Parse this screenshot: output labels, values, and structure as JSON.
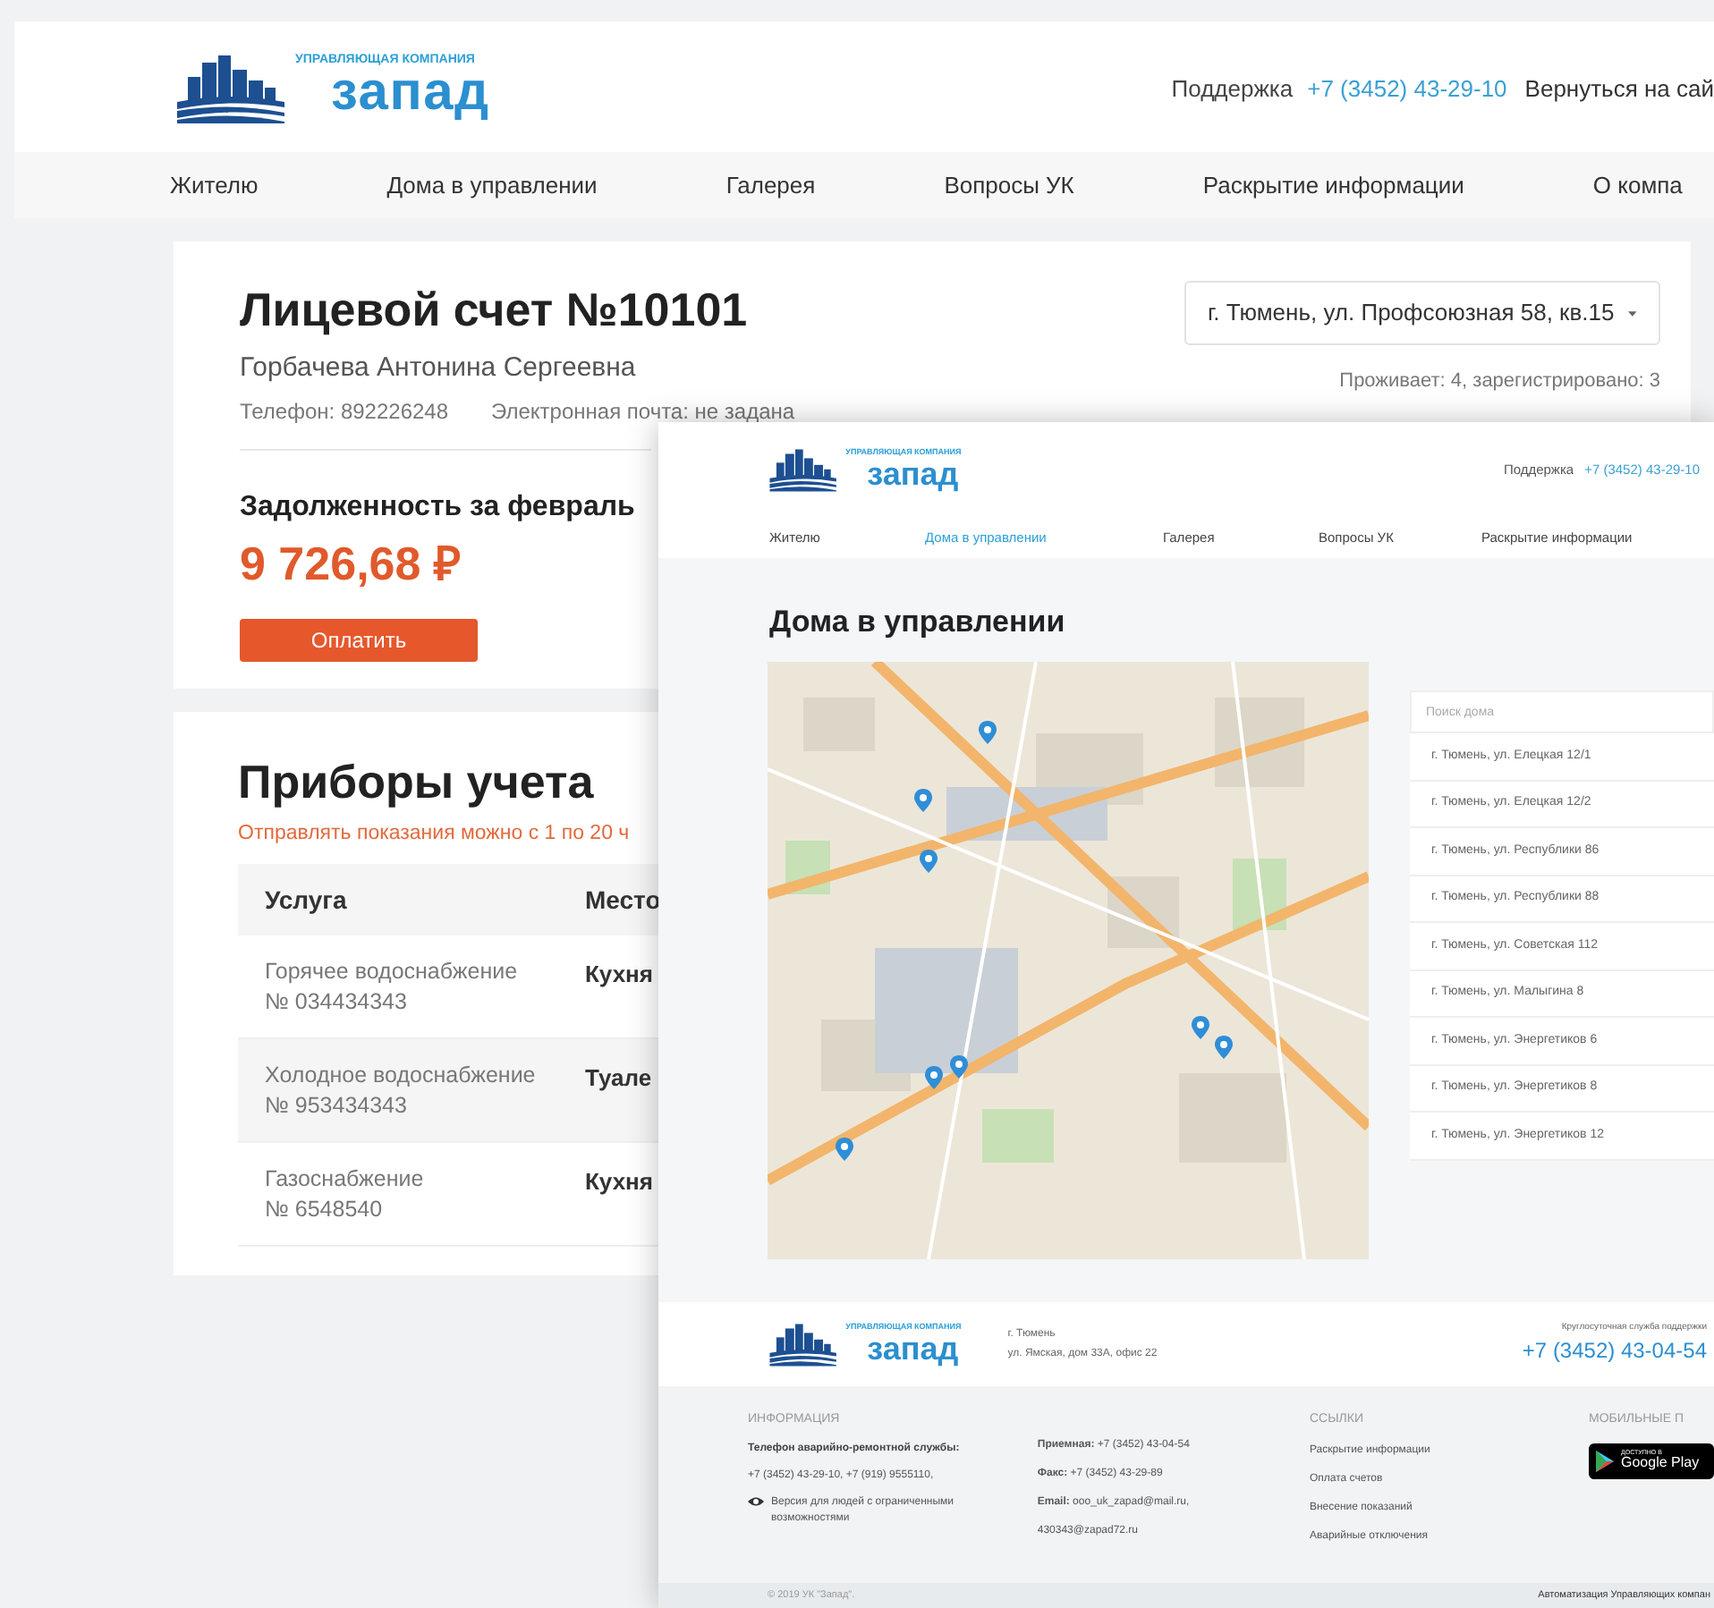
{
  "back_page": {
    "header": {
      "logo_tagline": "УПРАВЛЯЮЩАЯ КОМПАНИЯ",
      "logo_name": "запад",
      "support_label": "Поддержка",
      "support_phone": "+7 (3452) 43-29-10",
      "back_link": "Вернуться на сай"
    },
    "nav": [
      {
        "label": "Жителю",
        "selected": false
      },
      {
        "label": "Дома в управлении",
        "selected": false
      },
      {
        "label": "Галерея",
        "selected": false
      },
      {
        "label": "Вопросы УК",
        "selected": false
      },
      {
        "label": "Раскрытие информации",
        "selected": false
      },
      {
        "label": "О компа",
        "selected": false
      }
    ],
    "account": {
      "title": "Лицевой счет №10101",
      "owner": "Горбачева Антонина Сергеевна",
      "phone": "Телефон: 892226248",
      "email": "Электронная почта: не задана",
      "address_select": "г. Тюмень, ул. Профсоюзная 58, кв.15",
      "residents": "Проживает: 4, зарегистрировано: 3",
      "debt_label": "Задолженность за февраль",
      "debt_amount": "9 726,68 ₽",
      "pay_button": "Оплатить"
    },
    "meters": {
      "title": "Приборы учета",
      "note": "Отправлять показания можно с 1 по 20 ч",
      "columns": [
        "Услуга",
        "Место"
      ],
      "rows": [
        {
          "service": "Горячее водоснабжение",
          "number": "№ 034434343",
          "location": "Кухня"
        },
        {
          "service": "Холодное водоснабжение",
          "number": "№ 953434343",
          "location": "Туале"
        },
        {
          "service": "Газоснабжение",
          "number": "№ 6548540",
          "location": "Кухня"
        }
      ]
    }
  },
  "front_page": {
    "header": {
      "logo_tagline": "УПРАВЛЯЮЩАЯ КОМПАНИЯ",
      "logo_name": "запад",
      "support_label": "Поддержка",
      "support_phone": "+7 (3452) 43-29-10"
    },
    "nav": [
      {
        "label": "Жителю",
        "selected": false
      },
      {
        "label": "Дома в управлении",
        "selected": true
      },
      {
        "label": "Галерея",
        "selected": false
      },
      {
        "label": "Вопросы УК",
        "selected": false
      },
      {
        "label": "Раскрытие информации",
        "selected": false
      }
    ],
    "title": "Дома в управлении",
    "search": {
      "placeholder": "Поиск дома"
    },
    "houses": [
      "г. Тюмень, ул. Елецкая 12/1",
      "г. Тюмень, ул. Елецкая 12/2",
      "г. Тюмень, ул. Республики 86",
      "г. Тюмень, ул. Республики 88",
      "г. Тюмень, ул. Советская 112",
      "г. Тюмень, ул. Малыгина 8",
      "г. Тюмень, ул. Энергетиков 6",
      "г. Тюмень, ул. Энергетиков 8",
      "г. Тюмень, ул. Энергетиков 12"
    ],
    "footer": {
      "logo_tagline": "УПРАВЛЯЮЩАЯ КОМПАНИЯ",
      "logo_name": "запад",
      "address": [
        "г. Тюмень",
        "ул. Ямская, дом 33А, офис 22"
      ],
      "support_label": "Круглосуточная служба поддержки",
      "support_phone": "+7 (3452) 43-04-54",
      "info_heading": "ИНФОРМАЦИЯ",
      "emergency_label": "Телефон аварийно-ремонтной службы:",
      "emergency_phones": "+7 (3452) 43-29-10,  +7 (919) 9555110,",
      "accessibility_link": "Версия для людей с ограниченными возможностями",
      "contacts": [
        "**Приемная:** +7 (3452) 43-04-54",
        "**Факс:** +7 (3452) 43-29-89",
        "**Email:** ooo_uk_zapad@mail.ru,",
        "430343@zapad72.ru"
      ],
      "links_heading": "ССЫЛКИ",
      "links": [
        "Раскрытие информации",
        "Оплата счетов",
        "Внесение показаний",
        "Аварийные отключения"
      ],
      "apps_heading": "МОБИЛЬНЫЕ П",
      "store_badge": {
        "small": "ДОСТУПНО В",
        "name": "Google Play"
      },
      "copyright": "© 2019 УК \"Запад\".",
      "credit": "Автоматизация Управляющих компан"
    }
  }
}
